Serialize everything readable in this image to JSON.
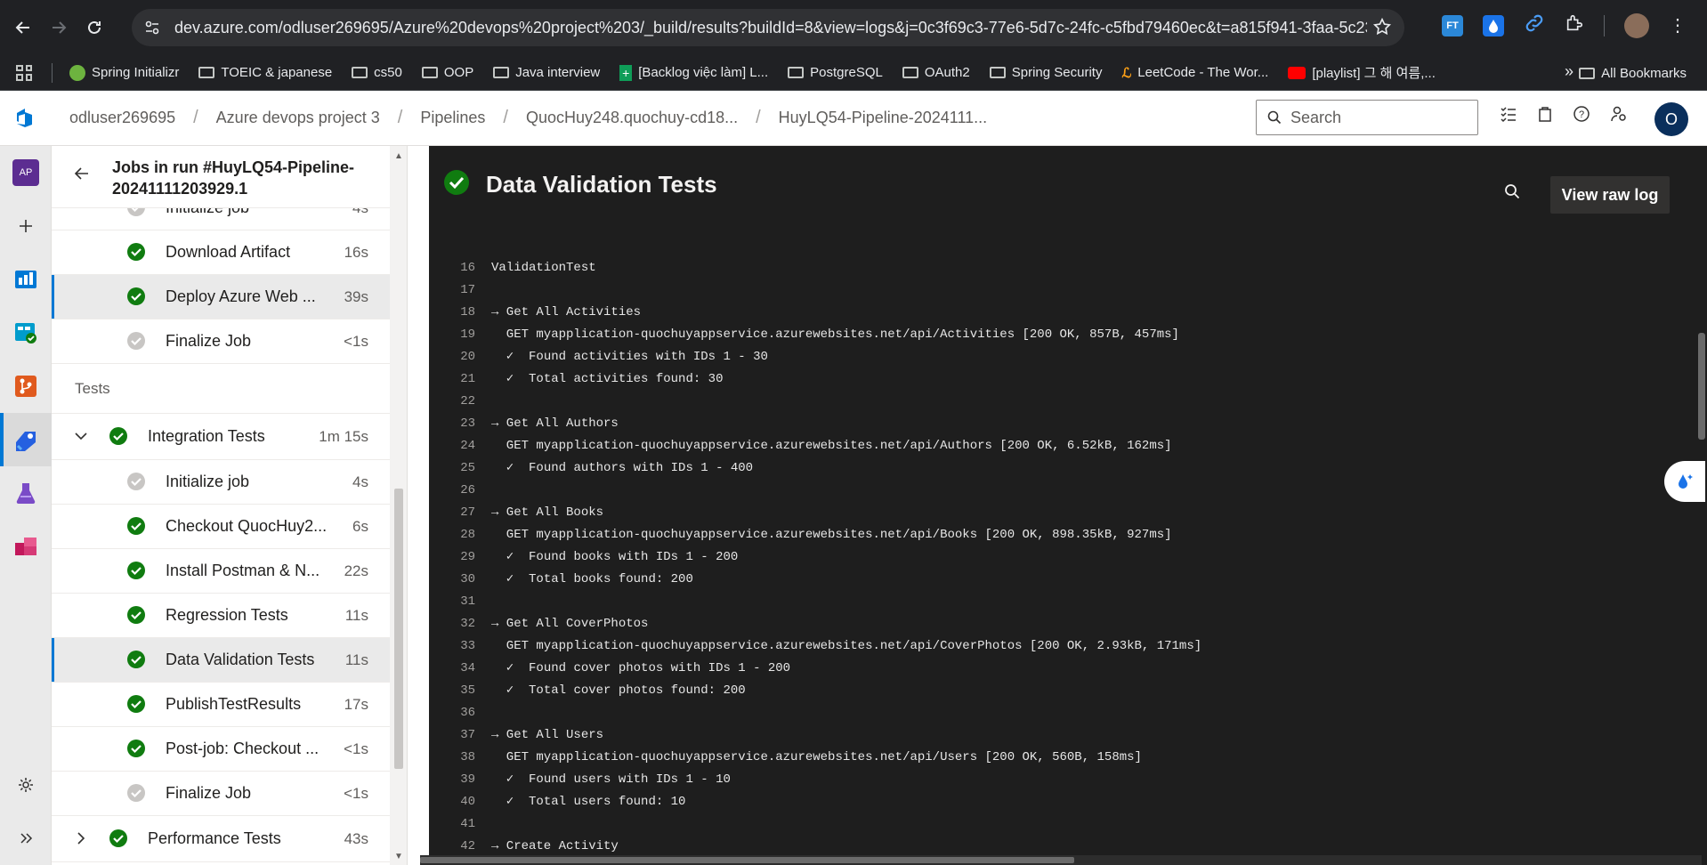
{
  "browser": {
    "url": "dev.azure.com/odluser269695/Azure%20devops%20project%203/_build/results?buildId=8&view=logs&j=0c3f69c3-77e6-5d7c-24fc-c5fbd79460ec&t=a815f941-3faa-5c23-65...",
    "extensions": [
      "FT",
      "drop-icon",
      "link-icon",
      "puzzle-icon"
    ],
    "bookmarks": [
      {
        "label": "Spring Initializr",
        "icon": "spring-icon"
      },
      {
        "label": "TOEIC & japanese",
        "icon": "folder-icon"
      },
      {
        "label": "cs50",
        "icon": "folder-icon"
      },
      {
        "label": "OOP",
        "icon": "folder-icon"
      },
      {
        "label": "Java interview",
        "icon": "folder-icon"
      },
      {
        "label": "[Backlog việc làm] L...",
        "icon": "sheets-icon"
      },
      {
        "label": "PostgreSQL",
        "icon": "folder-icon"
      },
      {
        "label": "OAuth2",
        "icon": "folder-icon"
      },
      {
        "label": "Spring Security",
        "icon": "folder-icon"
      },
      {
        "label": "LeetCode - The Wor...",
        "icon": "leetcode-icon"
      },
      {
        "label": "[playlist] 그 해 여름,...",
        "icon": "youtube-icon"
      }
    ],
    "more_bookmarks": "»",
    "all_bookmarks": "All Bookmarks"
  },
  "header": {
    "breadcrumbs": [
      "odluser269695",
      "Azure devops project 3",
      "Pipelines",
      "QuocHuy248.quochuy-cd18...",
      "HuyLQ54-Pipeline-2024111..."
    ],
    "search_placeholder": "Search",
    "user_initial": "O"
  },
  "rail": {
    "project_badge": "AP"
  },
  "jobs_panel": {
    "title": "Jobs in run #HuyLQ54-Pipeline-20241111203929.1",
    "partial_step": {
      "name": "Initialize job",
      "duration": "4s"
    },
    "steps_top": [
      {
        "name": "Download Artifact",
        "duration": "16s",
        "status": "success"
      },
      {
        "name": "Deploy Azure Web ...",
        "duration": "39s",
        "status": "success",
        "selected": true
      },
      {
        "name": "Finalize Job",
        "duration": "<1s",
        "status": "skipped"
      }
    ],
    "group_label": "Tests",
    "job": {
      "name": "Integration Tests",
      "duration": "1m 15s",
      "status": "success",
      "expanded": true
    },
    "job_steps": [
      {
        "name": "Initialize job",
        "duration": "4s",
        "status": "skipped"
      },
      {
        "name": "Checkout QuocHuy2...",
        "duration": "6s",
        "status": "success"
      },
      {
        "name": "Install Postman & N...",
        "duration": "22s",
        "status": "success"
      },
      {
        "name": "Regression Tests",
        "duration": "11s",
        "status": "success"
      },
      {
        "name": "Data Validation Tests",
        "duration": "11s",
        "status": "success",
        "selected": true
      },
      {
        "name": "PublishTestResults",
        "duration": "17s",
        "status": "success"
      },
      {
        "name": "Post-job: Checkout ...",
        "duration": "<1s",
        "status": "success"
      },
      {
        "name": "Finalize Job",
        "duration": "<1s",
        "status": "skipped"
      }
    ],
    "job2": {
      "name": "Performance Tests",
      "duration": "43s",
      "status": "success",
      "expanded": false
    }
  },
  "log": {
    "title": "Data Validation Tests",
    "view_raw_label": "View raw log",
    "lines": [
      {
        "no": "16",
        "text": "ValidationTest"
      },
      {
        "no": "17",
        "text": ""
      },
      {
        "no": "18",
        "text": "→ Get All Activities"
      },
      {
        "no": "19",
        "text": "  GET myapplication-quochuyappservice.azurewebsites.net/api/Activities [200 OK, 857B, 457ms]"
      },
      {
        "no": "20",
        "text": "  ✓  Found activities with IDs 1 - 30"
      },
      {
        "no": "21",
        "text": "  ✓  Total activities found: 30"
      },
      {
        "no": "22",
        "text": ""
      },
      {
        "no": "23",
        "text": "→ Get All Authors"
      },
      {
        "no": "24",
        "text": "  GET myapplication-quochuyappservice.azurewebsites.net/api/Authors [200 OK, 6.52kB, 162ms]"
      },
      {
        "no": "25",
        "text": "  ✓  Found authors with IDs 1 - 400"
      },
      {
        "no": "26",
        "text": ""
      },
      {
        "no": "27",
        "text": "→ Get All Books"
      },
      {
        "no": "28",
        "text": "  GET myapplication-quochuyappservice.azurewebsites.net/api/Books [200 OK, 898.35kB, 927ms]"
      },
      {
        "no": "29",
        "text": "  ✓  Found books with IDs 1 - 200"
      },
      {
        "no": "30",
        "text": "  ✓  Total books found: 200"
      },
      {
        "no": "31",
        "text": ""
      },
      {
        "no": "32",
        "text": "→ Get All CoverPhotos"
      },
      {
        "no": "33",
        "text": "  GET myapplication-quochuyappservice.azurewebsites.net/api/CoverPhotos [200 OK, 2.93kB, 171ms]"
      },
      {
        "no": "34",
        "text": "  ✓  Found cover photos with IDs 1 - 200"
      },
      {
        "no": "35",
        "text": "  ✓  Total cover photos found: 200"
      },
      {
        "no": "36",
        "text": ""
      },
      {
        "no": "37",
        "text": "→ Get All Users"
      },
      {
        "no": "38",
        "text": "  GET myapplication-quochuyappservice.azurewebsites.net/api/Users [200 OK, 560B, 158ms]"
      },
      {
        "no": "39",
        "text": "  ✓  Found users with IDs 1 - 10"
      },
      {
        "no": "40",
        "text": "  ✓  Total users found: 10"
      },
      {
        "no": "41",
        "text": ""
      },
      {
        "no": "42",
        "text": "→ Create Activity"
      }
    ]
  },
  "colors": {
    "success": "#107c10",
    "skipped": "#c8c6c4",
    "accent": "#0078d4",
    "log_bg": "#1e1e1e"
  }
}
